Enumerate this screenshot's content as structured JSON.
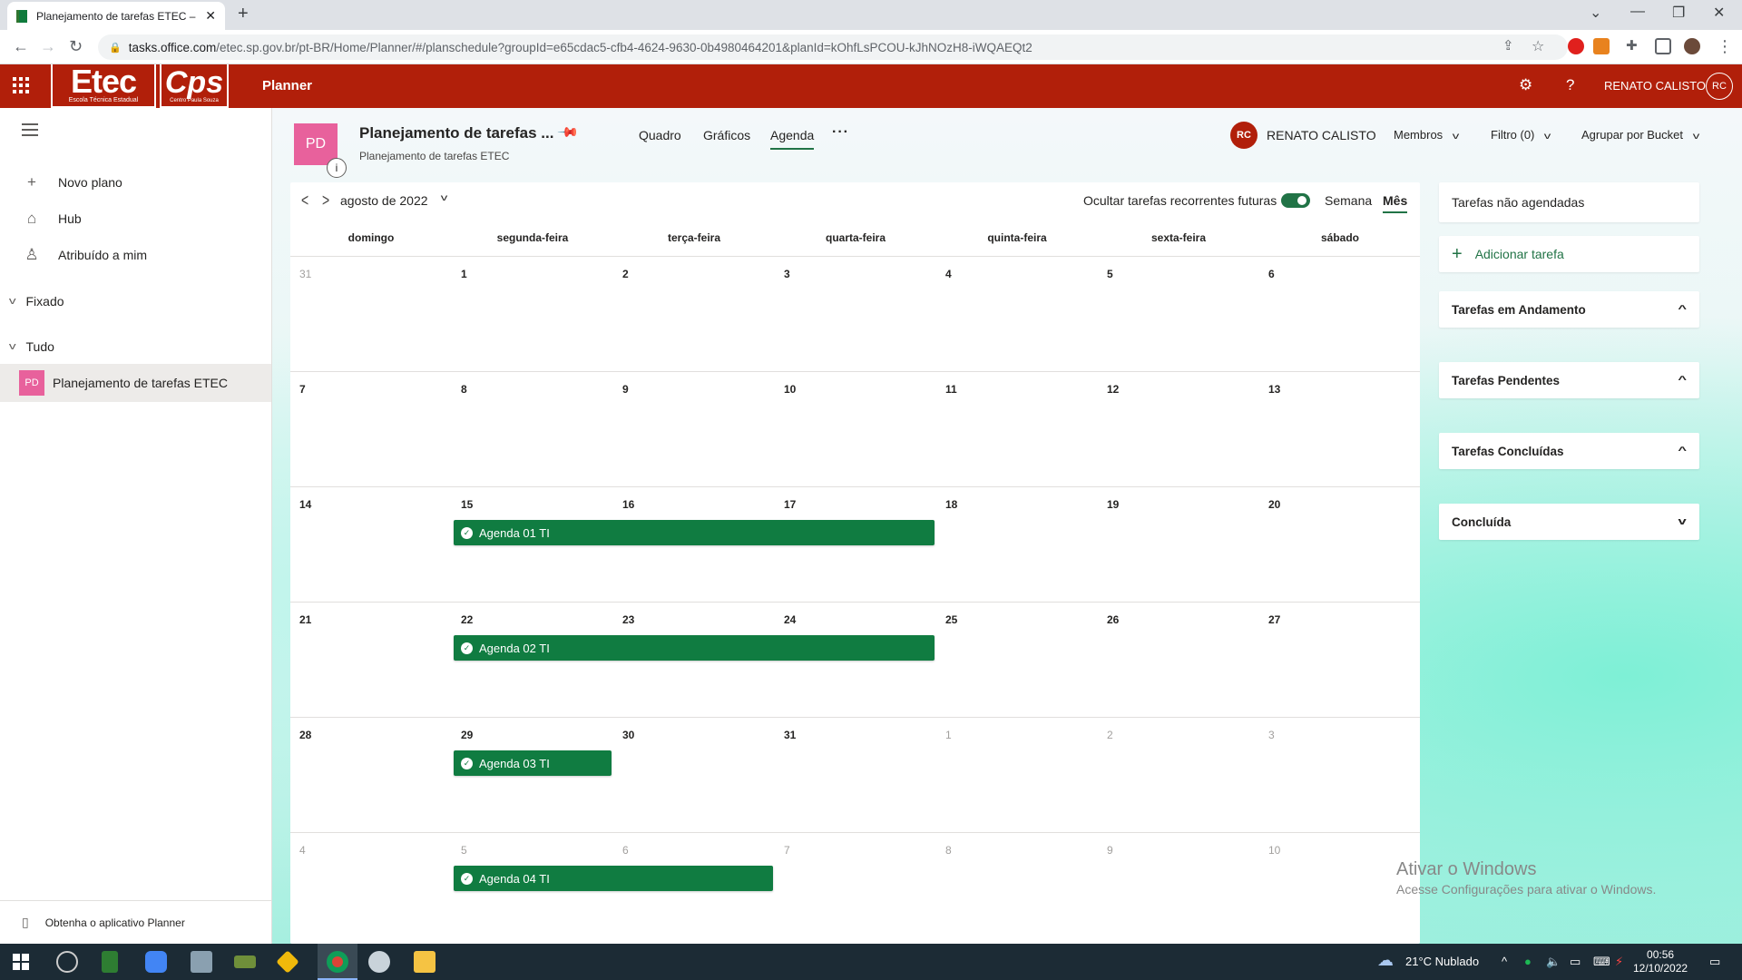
{
  "browser": {
    "tab_title": "Planejamento de tarefas ETEC – P",
    "url_host": "tasks.office.com",
    "url_path": "/etec.sp.gov.br/pt-BR/Home/Planner/#/planschedule?groupId=e65cdac5-cfb4-4624-9630-0b4980464201&planId=kOhfLsPCOU-kJhNOzH8-iWQAEQt2"
  },
  "suite": {
    "logo_etec": "Etec",
    "logo_etec_sub": "Escola Técnica Estadual",
    "logo_cps": "Cps",
    "logo_cps_sub": "Centro Paula Souza",
    "app_name": "Planner",
    "user_name": "RENATO CALISTO",
    "user_initials": "RC"
  },
  "leftnav": {
    "items": [
      {
        "label": "Novo plano",
        "icon": "plus-icon"
      },
      {
        "label": "Hub",
        "icon": "home-icon"
      },
      {
        "label": "Atribuído a mim",
        "icon": "person-icon"
      }
    ],
    "section_pinned": "Fixado",
    "section_all": "Tudo",
    "plan_initials": "PD",
    "plan_name": "Planejamento de tarefas ETEC",
    "footer": "Obtenha o aplicativo Planner"
  },
  "plan": {
    "initials": "PD",
    "title": "Planejamento de tarefas ...",
    "subtitle": "Planejamento de tarefas ETEC",
    "tabs": [
      "Quadro",
      "Gráficos",
      "Agenda"
    ],
    "active_tab": "Agenda",
    "member_initials": "RC",
    "member_name": "RENATO CALISTO",
    "members_label": "Membros",
    "filter_label": "Filtro (0)",
    "group_label": "Agrupar por Bucket"
  },
  "calendar": {
    "month_label": "agosto de 2022",
    "recurring_label": "Ocultar tarefas recorrentes futuras",
    "recurring_on": true,
    "range_week": "Semana",
    "range_month": "Mês",
    "weekdays": [
      "domingo",
      "segunda-feira",
      "terça-feira",
      "quarta-feira",
      "quinta-feira",
      "sexta-feira",
      "sábado"
    ],
    "weeks": [
      [
        {
          "d": "31",
          "m": true
        },
        {
          "d": "1"
        },
        {
          "d": "2"
        },
        {
          "d": "3"
        },
        {
          "d": "4"
        },
        {
          "d": "5"
        },
        {
          "d": "6"
        }
      ],
      [
        {
          "d": "7"
        },
        {
          "d": "8"
        },
        {
          "d": "9"
        },
        {
          "d": "10"
        },
        {
          "d": "11"
        },
        {
          "d": "12"
        },
        {
          "d": "13"
        }
      ],
      [
        {
          "d": "14"
        },
        {
          "d": "15"
        },
        {
          "d": "16"
        },
        {
          "d": "17"
        },
        {
          "d": "18"
        },
        {
          "d": "19"
        },
        {
          "d": "20"
        }
      ],
      [
        {
          "d": "21"
        },
        {
          "d": "22"
        },
        {
          "d": "23"
        },
        {
          "d": "24"
        },
        {
          "d": "25"
        },
        {
          "d": "26"
        },
        {
          "d": "27"
        }
      ],
      [
        {
          "d": "28"
        },
        {
          "d": "29"
        },
        {
          "d": "30"
        },
        {
          "d": "31"
        },
        {
          "d": "1",
          "m": true
        },
        {
          "d": "2",
          "m": true
        },
        {
          "d": "3",
          "m": true
        }
      ],
      [
        {
          "d": "4",
          "m": true
        },
        {
          "d": "5",
          "m": true
        },
        {
          "d": "6",
          "m": true
        },
        {
          "d": "7",
          "m": true
        },
        {
          "d": "8",
          "m": true
        },
        {
          "d": "9",
          "m": true
        },
        {
          "d": "10",
          "m": true
        }
      ]
    ],
    "events": [
      {
        "title": "Agenda 01 TI",
        "week": 2,
        "start_day": 1,
        "span_days": 3
      },
      {
        "title": "Agenda 02 TI",
        "week": 3,
        "start_day": 1,
        "span_days": 3
      },
      {
        "title": "Agenda 03 TI",
        "week": 4,
        "start_day": 1,
        "span_days": 1
      },
      {
        "title": "Agenda 04 TI",
        "week": 5,
        "start_day": 1,
        "span_days": 2
      }
    ],
    "event_color": "#107c41"
  },
  "right_panel": {
    "unscheduled": "Tarefas não agendadas",
    "add_task": "Adicionar tarefa",
    "groups": [
      {
        "label": "Tarefas em Andamento",
        "expanded": true
      },
      {
        "label": "Tarefas Pendentes",
        "expanded": true
      },
      {
        "label": "Tarefas Concluídas",
        "expanded": true
      },
      {
        "label": "Concluída",
        "expanded": false
      }
    ]
  },
  "watermark": {
    "line1": "Ativar o Windows",
    "line2": "Acesse Configurações para ativar o Windows."
  },
  "taskbar": {
    "weather": "21°C  Nublado",
    "time": "00:56",
    "date": "12/10/2022"
  },
  "colors": {
    "brand_red": "#b11f0a",
    "accent_green": "#217346",
    "plan_pink": "#e8619c"
  }
}
